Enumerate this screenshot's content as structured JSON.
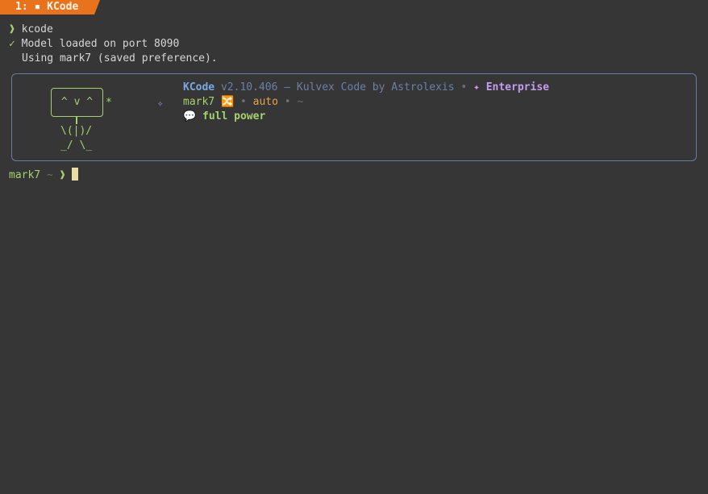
{
  "tab": {
    "label": "1: ▪ KCode"
  },
  "terminal": {
    "prompt_glyph": "❱",
    "command": "kcode",
    "check_glyph": "✓",
    "loaded_text": "Model loaded on port 8090",
    "using_text": "Using mark7 (saved preference)."
  },
  "banner": {
    "face": "^ v ^",
    "star": "*",
    "arms": "\\(|)/",
    "legs": "_/ \\_",
    "sparkle": "✧",
    "brand": "KCode",
    "version_text": "v2.10.406 — Kulvex Code by Astrolexis",
    "sep": "•",
    "edition_glyph": "✦",
    "edition": "Enterprise",
    "model": "mark7",
    "mode_icon": "🔀",
    "mode": "auto",
    "cwd": "~",
    "power_icon": "💬",
    "power_text": "full power"
  },
  "prompt": {
    "user": "mark7",
    "path": "~",
    "glyph": "❱"
  },
  "colors": {
    "background": "#363636",
    "tab": "#e8731c",
    "green": "#a3d26e",
    "brand": "#7aa7e6",
    "enterprise": "#c79cf0",
    "auto": "#e6a24a",
    "border": "#6c7a9e",
    "cursor": "#ecdca0"
  }
}
